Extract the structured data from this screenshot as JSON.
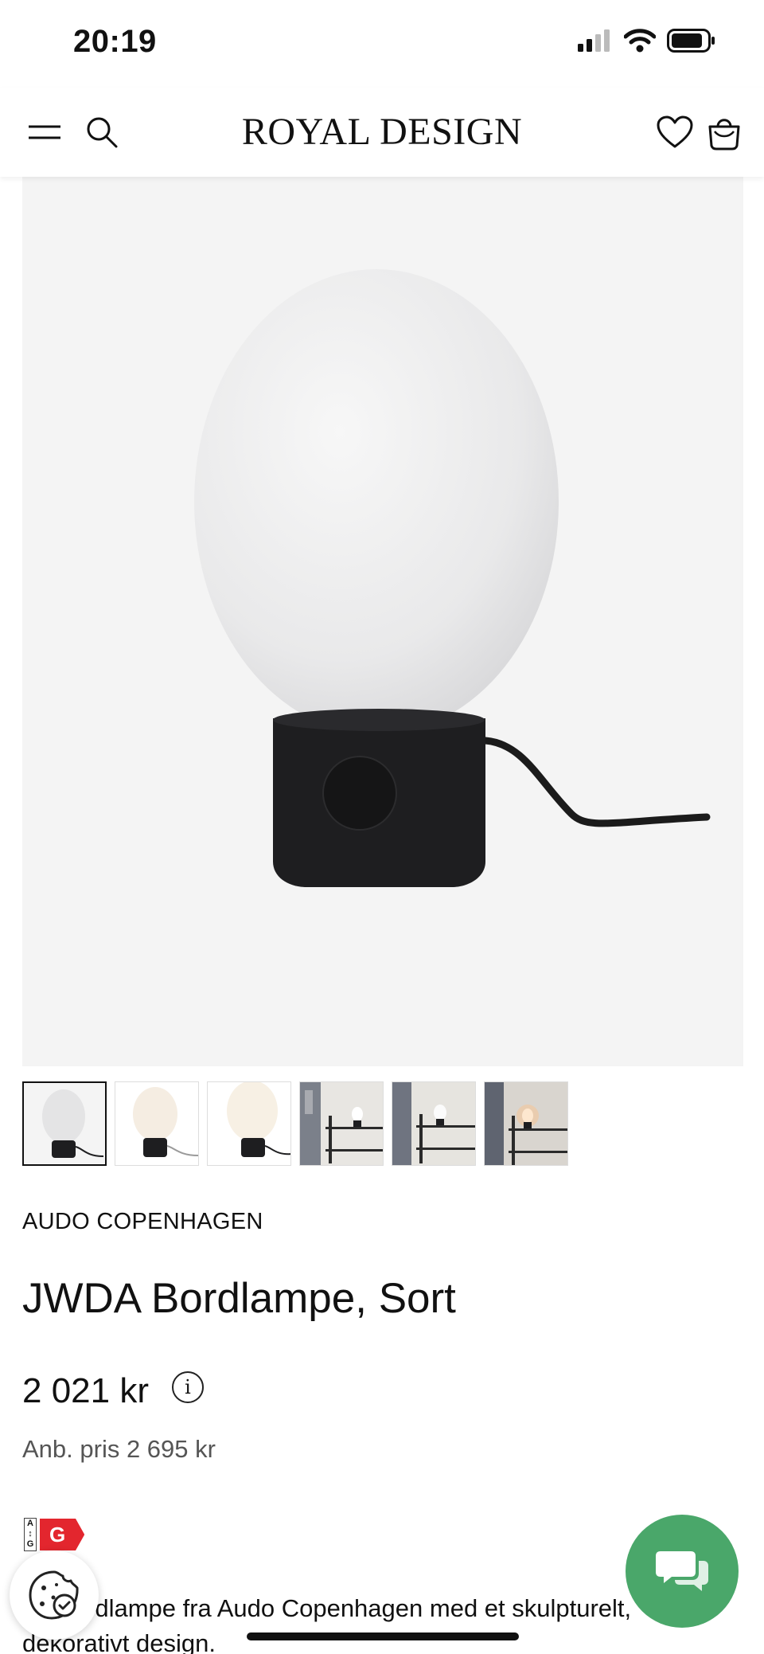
{
  "status_bar": {
    "time": "20:19",
    "icons": [
      "signal-icon",
      "wifi-icon",
      "battery-icon"
    ]
  },
  "header": {
    "logo": "ROYAL DESIGN",
    "left_icons": [
      "menu-icon",
      "search-icon"
    ],
    "right_icons": [
      "heart-icon",
      "bag-icon"
    ]
  },
  "gallery": {
    "thumbnail_count": 6,
    "active_index": 0
  },
  "product": {
    "brand": "AUDO COPENHAGEN",
    "title": "JWDA Bordlampe, Sort",
    "price": "2 021 kr",
    "info_glyph": "i",
    "recommended_price": "Anb. pris 2 695 kr",
    "energy_class": "G",
    "energy_scale_top": "A",
    "energy_scale_bottom": "G",
    "description": "En bordlampe fra Audo Copenhagen med et skulpturelt, dekorativt design."
  },
  "colors": {
    "accent_green": "#4aa76a",
    "energy_red": "#e3262e",
    "hero_bg": "#f4f4f4"
  }
}
